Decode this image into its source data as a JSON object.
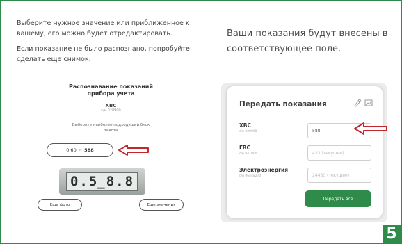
{
  "left": {
    "paragraph1": "Выберите нужное значение или приближенное к вашему, его можно будет отредактировать.",
    "paragraph2": "Если показание не было распознано, попробуйте сделать еще снимок."
  },
  "phone": {
    "title": "Распознавание показаний прибора учета",
    "meter_name": "ХВС",
    "meter_id": "с/н 028900",
    "hint": "Выберите наиболее подходящий блок текста",
    "choice_left": "0.60",
    "choice_sep": "←",
    "choice_right": "588",
    "meter_reading": "0.5̲8.8",
    "button_more_photo": "Еще фото",
    "button_more_values": "Еще значения"
  },
  "right": {
    "text": "Ваши показания будут внесены в соответствующее поле."
  },
  "card": {
    "title": "Передать показания",
    "rows": [
      {
        "label": "ХВС",
        "id": "с/н 028900",
        "value": "588",
        "is_placeholder": false
      },
      {
        "label": "ГВС",
        "id": "с/н 041900",
        "value": "433 (текущее)",
        "is_placeholder": true
      },
      {
        "label": "Электроэнергия",
        "id": "с/н 06448270",
        "value": "24430 (текущее)",
        "is_placeholder": true
      }
    ],
    "submit_label": "Передать все"
  },
  "badge": "5",
  "colors": {
    "accent_green": "#2e8b4a",
    "arrow_red": "#c0282d"
  }
}
